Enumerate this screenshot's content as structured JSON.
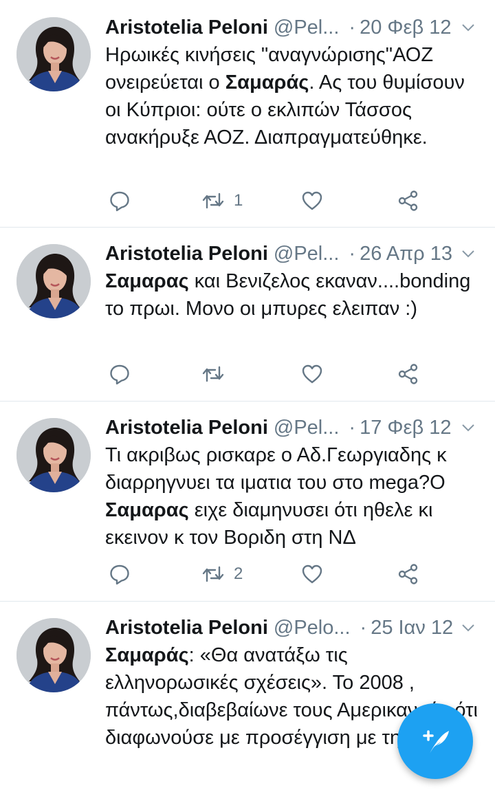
{
  "colors": {
    "accent": "#1da1f2",
    "text": "#14171a",
    "muted": "#657786",
    "divider": "#e1e8ed"
  },
  "icons": {
    "reply": "reply-icon",
    "retweet": "retweet-icon",
    "like": "heart-icon",
    "share": "share-icon",
    "caret": "chevron-down-icon",
    "compose": "compose-tweet-icon"
  },
  "tweets": [
    {
      "author": "Aristotelia Peloni",
      "handle": "@Pel...",
      "sep": "·",
      "date": "20 Φεβ 12",
      "text_pre": "Ηρωικές κινήσεις \"αναγνώρισης\"ΑΟΖ ονειρεύεται ο ",
      "text_bold": "Σαμαράς",
      "text_post": ". Ας του θυμίσουν οι Κύπριοι: ούτε ο εκλιπών Τάσσος ανακήρυξε ΑΟΖ. Διαπραγματεύθηκε.",
      "retweets": "1"
    },
    {
      "author": "Aristotelia Peloni",
      "handle": "@Pel...",
      "sep": "·",
      "date": "26 Απρ 13",
      "text_pre": "",
      "text_bold": "Σαμαρας",
      "text_post": " και Βενιζελος εκαναν....bonding το πρωι. Μονο οι μπυρες ελειπαν :)",
      "retweets": ""
    },
    {
      "author": "Aristotelia Peloni",
      "handle": "@Pel...",
      "sep": "·",
      "date": "17 Φεβ 12",
      "text_pre": "Τι ακριβως ρισκαρε ο Αδ.Γεωργιαδης κ διαρρηγνυει τα ιματια του στο mega?Ο ",
      "text_bold": "Σαμαρας",
      "text_post": " ειχε διαμηνυσει ότι ηθελε κι εκεινον κ τον Βοριδη στη ΝΔ",
      "retweets": "2"
    },
    {
      "author": "Aristotelia Peloni",
      "handle": "@Pelo...",
      "sep": "·",
      "date": "25 Ιαν 12",
      "text_pre": "",
      "text_bold": "Σαμαράς",
      "text_post": ": «Θα ανατάξω τις ελληνορωσικές σχέσεις». Το 2008 , πάντως,διαβεβαίωνε τους Αμερικανούς ότι διαφωνούσε με προσέγγιση με τη Ρωσία.",
      "retweets": ""
    }
  ]
}
